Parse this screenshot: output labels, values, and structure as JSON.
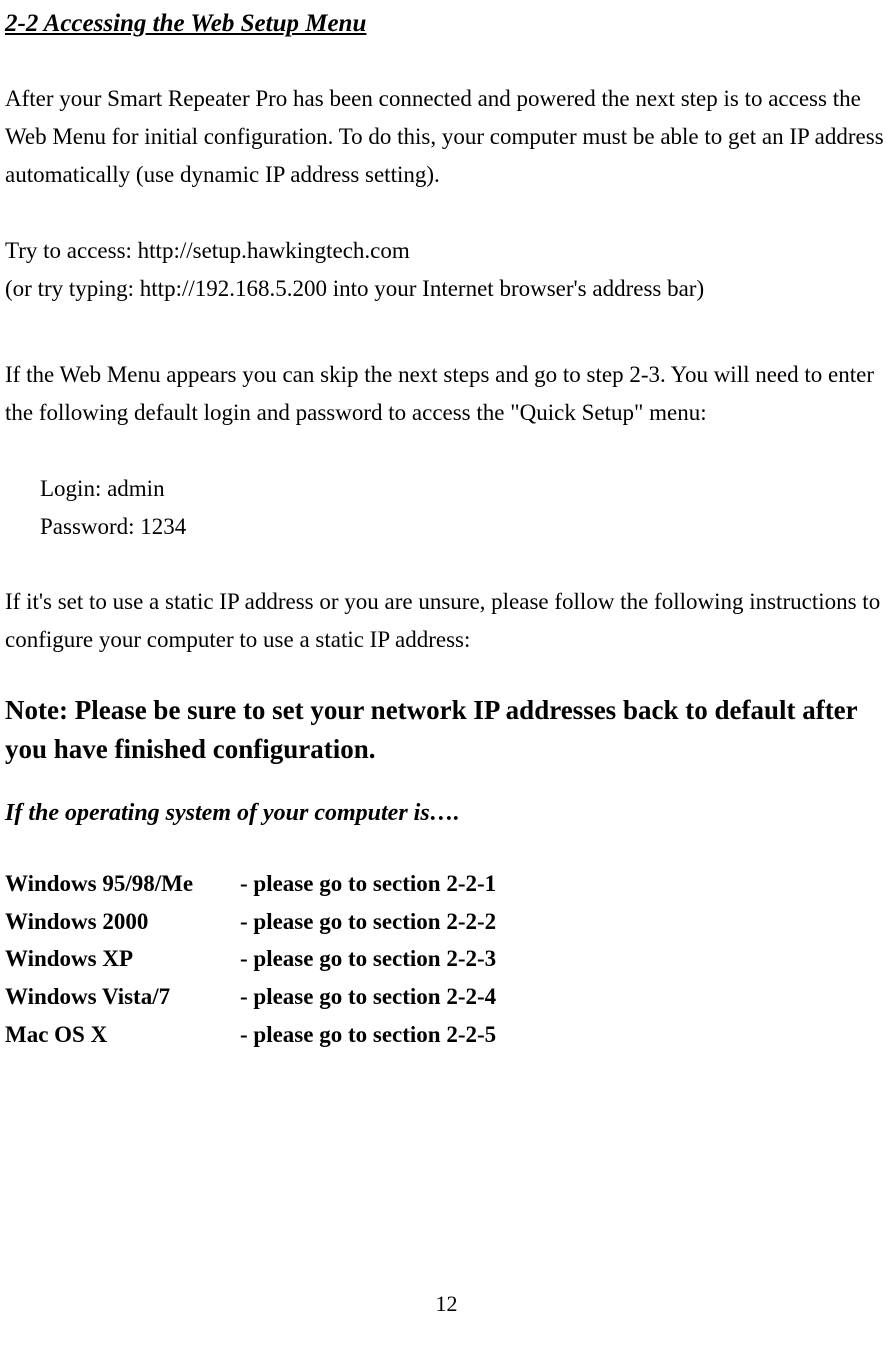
{
  "section_title": "2-2 Accessing the Web Setup Menu",
  "intro_paragraph": "After your Smart Repeater Pro has been connected and powered the next step is to access the Web Menu for initial configuration.    To do this, your computer must be able to get an IP address automatically (use dynamic IP address setting).",
  "try_access_line1": "Try to access: http://setup.hawkingtech.com",
  "try_access_line2": "(or try typing: http://192.168.5.200 into your Internet browser's address bar)",
  "web_menu_paragraph": "If the Web Menu appears you can skip the next steps and go to step 2-3.   You will need to enter the following default login and password to access the \"Quick Setup\" menu:",
  "login_line": "Login: admin",
  "password_line": "Password: 1234",
  "static_ip_paragraph": "If it's set to use a static IP address or you are unsure, please follow the following instructions to configure your computer to use a static IP address:",
  "note_heading": "Note: Please be sure to set your network IP addresses back to default after you have finished configuration.",
  "os_intro": "If the operating system of your computer is….",
  "os_list": [
    {
      "name": "Windows 95/98/Me",
      "section": "- please go to section 2-2-1"
    },
    {
      "name": "Windows 2000",
      "section": "- please go to section 2-2-2"
    },
    {
      "name": "Windows XP",
      "section": "- please go to section 2-2-3"
    },
    {
      "name": "Windows Vista/7",
      "section": "- please go to section 2-2-4"
    },
    {
      "name": "Mac OS X",
      "section": "- please go to section 2-2-5"
    }
  ],
  "page_number": "12"
}
